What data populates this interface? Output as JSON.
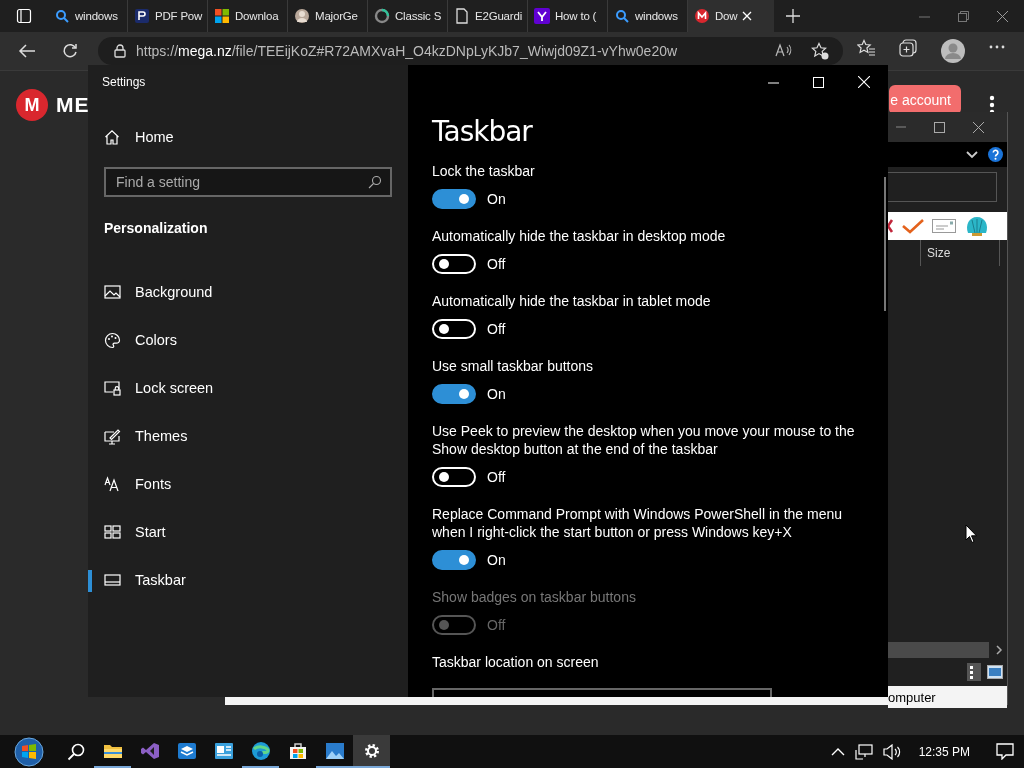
{
  "browser": {
    "tabs": [
      {
        "kind": "search",
        "title": "windows",
        "selected": false
      },
      {
        "kind": "pdf",
        "title": "PDF Pow",
        "selected": false
      },
      {
        "kind": "windows",
        "title": "Downloa",
        "selected": false
      },
      {
        "kind": "avatar",
        "title": "MajorGe",
        "selected": false
      },
      {
        "kind": "ring",
        "title": "Classic S",
        "selected": false
      },
      {
        "kind": "document",
        "title": "E2Guardi",
        "selected": false
      },
      {
        "kind": "yahoo",
        "title": "How to (",
        "selected": false
      },
      {
        "kind": "search",
        "title": "windows",
        "selected": false
      },
      {
        "kind": "mega",
        "title": "Dow",
        "selected": true
      }
    ],
    "url": {
      "scheme": "https://",
      "host": "mega.nz",
      "path": "/file/TEEijKoZ#R72AMXvaH_O4kzDNpLyKJb7_Wiwjd09Z1-vYhw0e20w"
    }
  },
  "page": {
    "logo_letter": "M",
    "logo_text": "ME",
    "account_button": "e account"
  },
  "settings": {
    "title": "Settings",
    "home": "Home",
    "search": {
      "placeholder": "Find a setting"
    },
    "section": "Personalization",
    "nav": [
      {
        "kind": "picture",
        "label": "Background",
        "selected": false
      },
      {
        "kind": "palette",
        "label": "Colors",
        "selected": false
      },
      {
        "kind": "lock",
        "label": "Lock screen",
        "selected": false
      },
      {
        "kind": "brush",
        "label": "Themes",
        "selected": false
      },
      {
        "kind": "fonts",
        "label": "Fonts",
        "selected": false
      },
      {
        "kind": "start",
        "label": "Start",
        "selected": false
      },
      {
        "kind": "taskbar",
        "label": "Taskbar",
        "selected": true
      }
    ],
    "heading": "Taskbar",
    "options": [
      {
        "label": "Lock the taskbar",
        "on": true,
        "state": "On",
        "disabled": false
      },
      {
        "label": "Automatically hide the taskbar in desktop mode",
        "on": false,
        "state": "Off",
        "disabled": false
      },
      {
        "label": "Automatically hide the taskbar in tablet mode",
        "on": false,
        "state": "Off",
        "disabled": false
      },
      {
        "label": "Use small taskbar buttons",
        "on": true,
        "state": "On",
        "disabled": false
      },
      {
        "label": "Use Peek to preview the desktop when you move your mouse to the Show desktop button at the end of the taskbar",
        "on": false,
        "state": "Off",
        "disabled": false
      },
      {
        "label": "Replace Command Prompt with Windows PowerShell in the menu when I right-click the start button or press Windows key+X",
        "on": true,
        "state": "On",
        "disabled": false
      },
      {
        "label": "Show badges on taskbar buttons",
        "on": false,
        "state": "Off",
        "disabled": true
      }
    ],
    "last_option": "Taskbar location on screen"
  },
  "back_window": {
    "column_header": "Size",
    "status": "omputer"
  },
  "taskbar": {
    "apps": [
      {
        "kind": "folder",
        "running": true,
        "selected": false
      },
      {
        "kind": "studio",
        "running": false,
        "selected": false
      },
      {
        "kind": "box",
        "running": false,
        "selected": false
      },
      {
        "kind": "card",
        "running": false,
        "selected": false
      },
      {
        "kind": "edge",
        "running": true,
        "selected": false
      },
      {
        "kind": "store",
        "running": false,
        "selected": false
      },
      {
        "kind": "photo",
        "running": true,
        "selected": false
      },
      {
        "kind": "gear",
        "running": true,
        "selected": true
      }
    ],
    "clock": "12:35 PM"
  }
}
